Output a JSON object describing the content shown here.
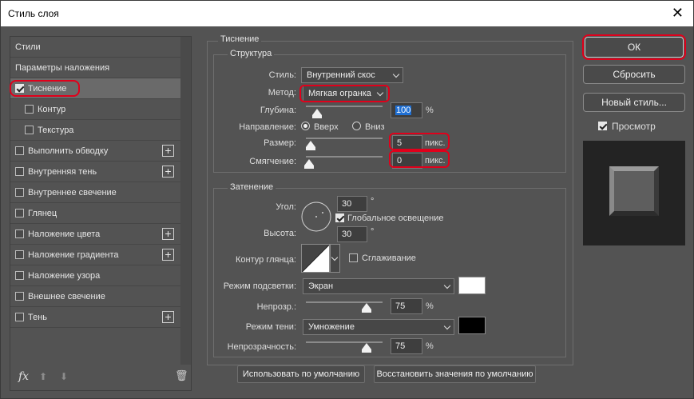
{
  "window": {
    "title": "Стиль слоя",
    "close_glyph": "✕"
  },
  "left_panel": {
    "items": [
      {
        "label": "Стили",
        "checkbox": false,
        "checked": false,
        "plus": false,
        "indent": 0,
        "selected": false
      },
      {
        "label": "Параметры наложения",
        "checkbox": false,
        "checked": false,
        "plus": false,
        "indent": 0,
        "selected": false
      },
      {
        "label": "Тиснение",
        "checkbox": true,
        "checked": true,
        "plus": false,
        "indent": 0,
        "selected": true
      },
      {
        "label": "Контур",
        "checkbox": true,
        "checked": false,
        "plus": false,
        "indent": 1,
        "selected": false
      },
      {
        "label": "Текстура",
        "checkbox": true,
        "checked": false,
        "plus": false,
        "indent": 1,
        "selected": false
      },
      {
        "label": "Выполнить обводку",
        "checkbox": true,
        "checked": false,
        "plus": true,
        "indent": 0,
        "selected": false
      },
      {
        "label": "Внутренняя тень",
        "checkbox": true,
        "checked": false,
        "plus": true,
        "indent": 0,
        "selected": false
      },
      {
        "label": "Внутреннее свечение",
        "checkbox": true,
        "checked": false,
        "plus": false,
        "indent": 0,
        "selected": false
      },
      {
        "label": "Глянец",
        "checkbox": true,
        "checked": false,
        "plus": false,
        "indent": 0,
        "selected": false
      },
      {
        "label": "Наложение цвета",
        "checkbox": true,
        "checked": false,
        "plus": true,
        "indent": 0,
        "selected": false
      },
      {
        "label": "Наложение градиента",
        "checkbox": true,
        "checked": false,
        "plus": true,
        "indent": 0,
        "selected": false
      },
      {
        "label": "Наложение узора",
        "checkbox": true,
        "checked": false,
        "plus": false,
        "indent": 0,
        "selected": false
      },
      {
        "label": "Внешнее свечение",
        "checkbox": true,
        "checked": false,
        "plus": false,
        "indent": 0,
        "selected": false
      },
      {
        "label": "Тень",
        "checkbox": true,
        "checked": false,
        "plus": true,
        "indent": 0,
        "selected": false
      }
    ],
    "footer": {
      "fx_label": "fx",
      "up_glyph": "⬆",
      "down_glyph": "⬇",
      "trash_glyph": "🗑"
    }
  },
  "bevel": {
    "title": "Тиснение",
    "structure": {
      "title": "Структура",
      "style_label": "Стиль:",
      "style_value": "Внутренний скос",
      "technique_label": "Метод:",
      "technique_value": "Мягкая огранка",
      "depth_label": "Глубина:",
      "depth_value": "100",
      "depth_unit": "%",
      "depth_pct": 10,
      "direction_label": "Направление:",
      "dir_up": "Вверх",
      "dir_down": "Вниз",
      "direction": "up",
      "size_label": "Размер:",
      "size_value": "5",
      "size_unit": "пикс.",
      "size_pct": 2,
      "soften_label": "Смягчение:",
      "soften_value": "0",
      "soften_unit": "пикс.",
      "soften_pct": 0
    },
    "shading": {
      "title": "Затенение",
      "angle_label": "Угол:",
      "angle_value": "30",
      "angle_unit": "°",
      "global_light_label": "Глобальное освещение",
      "global_light": true,
      "altitude_label": "Высота:",
      "altitude_value": "30",
      "altitude_unit": "°",
      "gloss_label": "Контур глянца:",
      "antialias_label": "Сглаживание",
      "antialias": false,
      "highlight_label": "Режим подсветки:",
      "highlight_mode": "Экран",
      "highlight_color": "#ffffff",
      "opacity1_label": "Непрозр.:",
      "opacity1_value": "75",
      "opacity1_unit": "%",
      "opacity1_pct": 75,
      "shadow_label": "Режим тени:",
      "shadow_mode": "Умножение",
      "shadow_color": "#000000",
      "opacity2_label": "Непрозрачность:",
      "opacity2_value": "75",
      "opacity2_unit": "%",
      "opacity2_pct": 75
    },
    "make_default": "Использовать по умолчанию",
    "reset_default": "Восстановить значения по умолчанию"
  },
  "right": {
    "ok": "ОК",
    "reset": "Сбросить",
    "new_style": "Новый стиль...",
    "preview_label": "Просмотр",
    "preview": true
  },
  "colors": {
    "highlight_ring": "#e0001b",
    "selection": "#1e6fd4"
  }
}
